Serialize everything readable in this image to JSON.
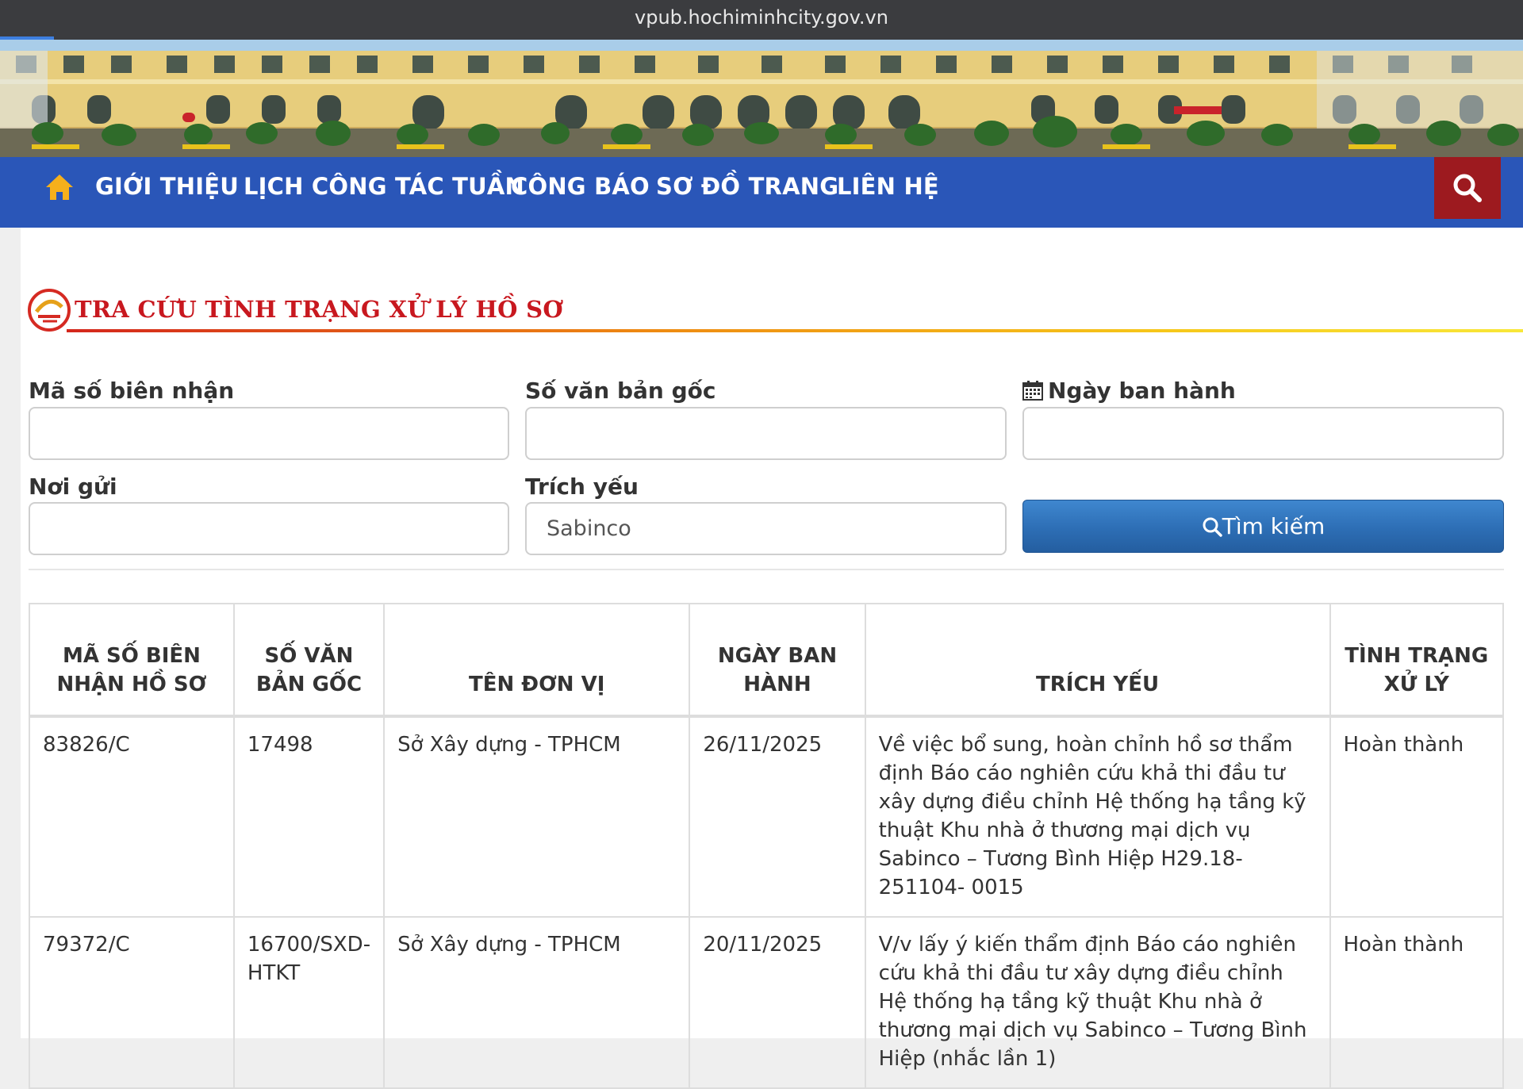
{
  "browser": {
    "url": "vpub.hochiminhcity.gov.vn"
  },
  "nav": {
    "items": [
      "GIỚI THIỆU",
      "LỊCH CÔNG TÁC TUẦN",
      "CÔNG BÁO",
      "SƠ ĐỒ TRANG",
      "LIÊN HỆ"
    ],
    "home_icon": "home-icon",
    "search_icon": "search-icon"
  },
  "section": {
    "title": "TRA CỨU TÌNH TRẠNG XỬ LÝ HỒ SƠ"
  },
  "form": {
    "ma_so_label": "Mã số biên nhận",
    "ma_so_value": "",
    "so_van_ban_label": "Số văn bản gốc",
    "so_van_ban_value": "",
    "ngay_label": "Ngày ban hành",
    "ngay_value": "",
    "noi_gui_label": "Nơi gửi",
    "noi_gui_value": "",
    "trich_yeu_label": "Trích yếu",
    "trich_yeu_value": "Sabinco",
    "search_label": "Tìm kiếm"
  },
  "table": {
    "headers": [
      "MÃ SỐ BIÊN NHẬN HỒ SƠ",
      "SỐ VĂN BẢN GỐC",
      "TÊN ĐƠN VỊ",
      "NGÀY BAN HÀNH",
      "TRÍCH YẾU",
      "TÌNH TRẠNG XỬ LÝ"
    ],
    "rows": [
      {
        "ma_so": "83826/C",
        "so_van_ban": "17498",
        "don_vi": "Sở Xây dựng - TPHCM",
        "ngay": "26/11/2025",
        "trich_yeu": "Về việc bổ sung, hoàn chỉnh hồ sơ thẩm định Báo cáo nghiên cứu khả thi đầu tư xây dựng điều chỉnh Hệ thống hạ tầng kỹ thuật Khu nhà ở thương mại dịch vụ Sabinco – Tương Bình Hiệp H29.18-251104- 0015",
        "tinh_trang": "Hoàn thành"
      },
      {
        "ma_so": "79372/C",
        "so_van_ban": "16700/SXD-HTKT",
        "don_vi": "Sở Xây dựng - TPHCM",
        "ngay": "20/11/2025",
        "trich_yeu": "V/v lấy ý kiến thẩm định Báo cáo nghiên cứu khả thi đầu tư xây dựng điều chỉnh Hệ thống hạ tầng kỹ thuật Khu nhà ở thương mại dịch vụ Sabinco – Tương Bình Hiệp (nhắc lần 1)",
        "tinh_trang": "Hoàn thành"
      }
    ]
  },
  "colors": {
    "nav": "#2a56b8",
    "search_nav": "#9d1a1f",
    "title": "#c8181f",
    "button": "#2d6eb5"
  }
}
